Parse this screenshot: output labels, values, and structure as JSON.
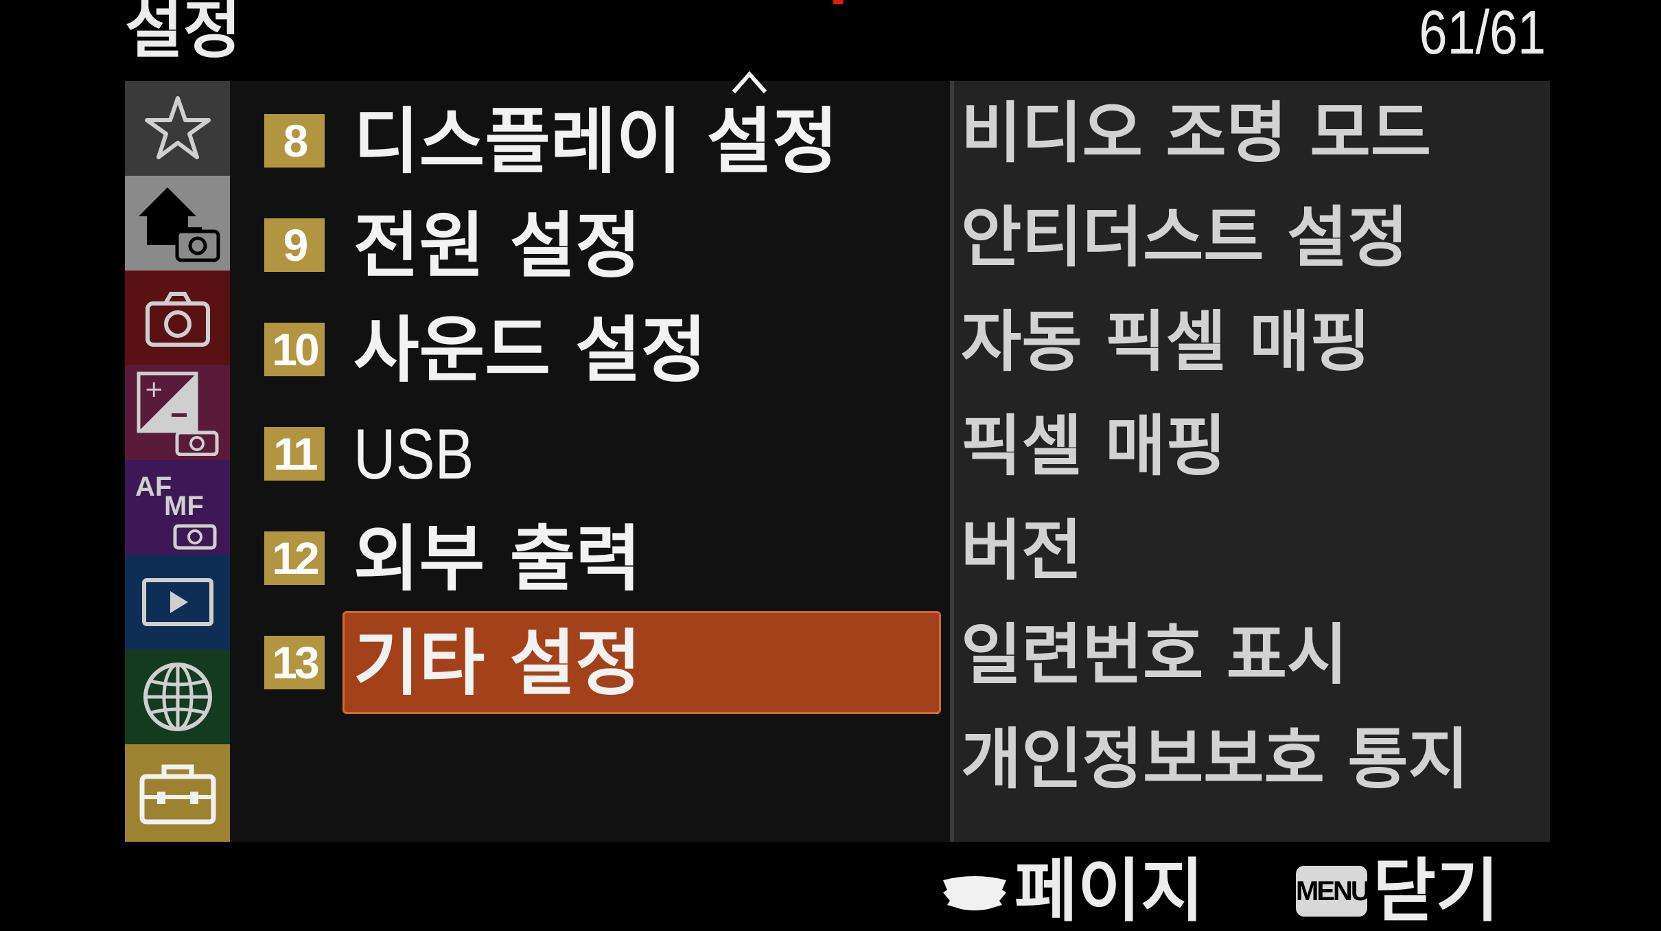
{
  "header": {
    "title": "설정",
    "page_counter": "61/61"
  },
  "sidebar": {
    "tabs": [
      {
        "name": "favorites",
        "icon": "star-icon",
        "color": "#3a3a3a"
      },
      {
        "name": "main",
        "icon": "home-camera-icon",
        "color": "#8a8a8a"
      },
      {
        "name": "shooting",
        "icon": "camera-icon",
        "color": "#5a1114"
      },
      {
        "name": "exposure-color",
        "icon": "exposure-comp-icon",
        "color": "#5a1a3a"
      },
      {
        "name": "focus",
        "icon": "af-mf-icon",
        "color": "#3e1856"
      },
      {
        "name": "playback",
        "icon": "playback-icon",
        "color": "#0e2e56"
      },
      {
        "name": "network",
        "icon": "globe-icon",
        "color": "#143a20"
      },
      {
        "name": "setup",
        "icon": "toolbox-icon",
        "color": "#9d8232",
        "active": true
      }
    ]
  },
  "menu": {
    "items": [
      {
        "num": "8",
        "label": "디스플레이 설정"
      },
      {
        "num": "9",
        "label": "전원 설정"
      },
      {
        "num": "10",
        "label": "사운드 설정"
      },
      {
        "num": "11",
        "label": "USB"
      },
      {
        "num": "12",
        "label": "외부 출력"
      },
      {
        "num": "13",
        "label": "기타 설정",
        "selected": true
      }
    ]
  },
  "details": {
    "items": [
      "비디오 조명 모드",
      "안티더스트 설정",
      "자동 픽셀 매핑",
      "픽셀 매핑",
      "버전",
      "일련번호 표시",
      "개인정보보호 통지"
    ]
  },
  "footer": {
    "page_label": "페이지",
    "close_key": "MENU",
    "close_label": "닫기"
  },
  "colors": {
    "selection": "#a3421a",
    "number_badge": "#b29540",
    "accent_red": "#e8160c"
  }
}
